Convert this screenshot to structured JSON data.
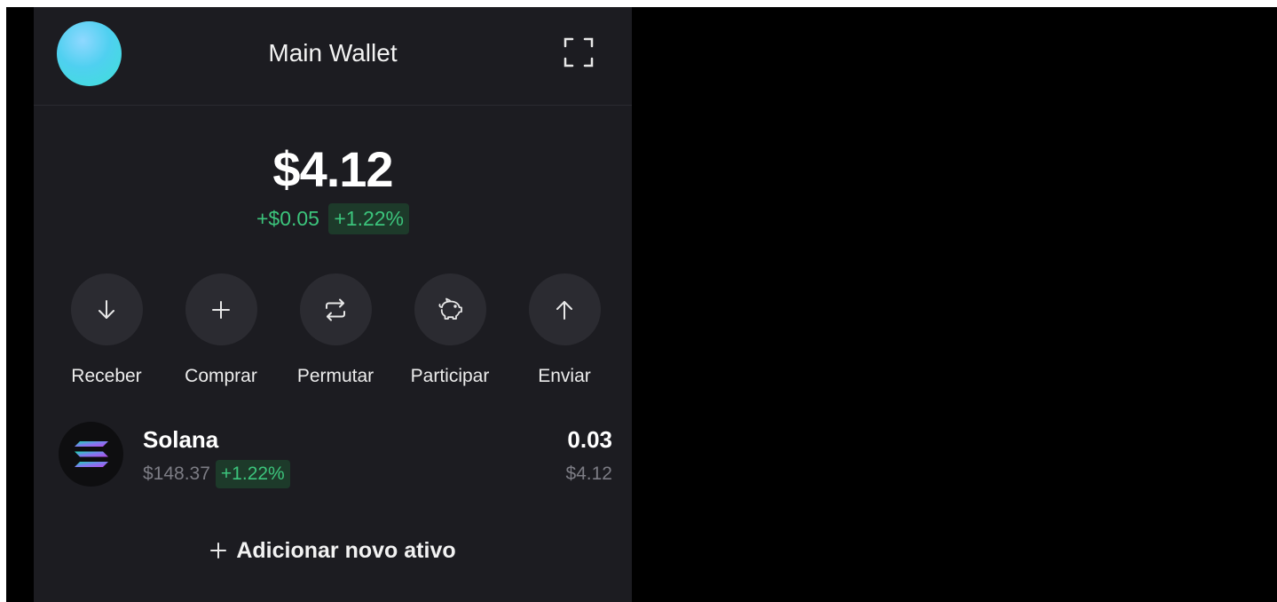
{
  "colors": {
    "panel_bg": "#1c1c21",
    "positive": "#3cc47c",
    "positive_bg": "#1d3a2a",
    "muted": "#7c7c84"
  },
  "header": {
    "title": "Main Wallet",
    "avatar_icon": "avatar-gradient",
    "expand_icon": "expand-icon"
  },
  "balance": {
    "total": "$4.12",
    "change_abs": "+$0.05",
    "change_pct": "+1.22%"
  },
  "actions": [
    {
      "label": "Receber",
      "icon": "arrow-down-icon"
    },
    {
      "label": "Comprar",
      "icon": "plus-icon"
    },
    {
      "label": "Permutar",
      "icon": "swap-icon"
    },
    {
      "label": "Participar",
      "icon": "piggy-bank-icon"
    },
    {
      "label": "Enviar",
      "icon": "arrow-up-icon"
    }
  ],
  "assets": [
    {
      "name": "Solana",
      "price": "$148.37",
      "change_pct": "+1.22%",
      "amount": "0.03",
      "value": "$4.12",
      "icon": "solana-icon"
    }
  ],
  "add_asset": {
    "label": "Adicionar novo ativo"
  }
}
